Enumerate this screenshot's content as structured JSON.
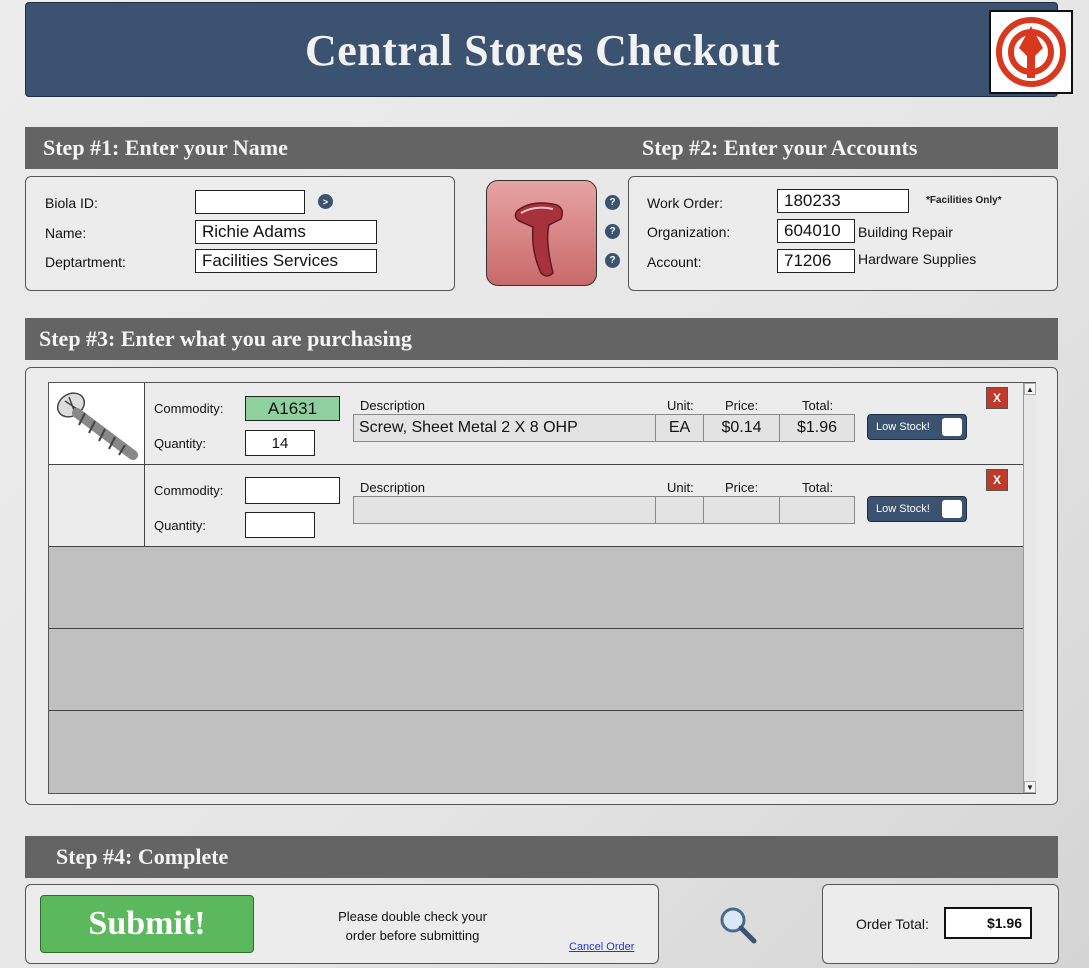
{
  "header": {
    "title": "Central Stores Checkout"
  },
  "step1": {
    "title": "Step #1: Enter your Name",
    "biola_id_label": "Biola ID:",
    "biola_id_value": "",
    "name_label": "Name:",
    "name_value": "Richie Adams",
    "department_label": "Deptartment:",
    "department_value": "Facilities Services"
  },
  "step2": {
    "title": "Step #2: Enter your Accounts",
    "work_order_label": "Work Order:",
    "work_order_value": "180233",
    "facilities_note": "*Facilities Only*",
    "organization_label": "Organization:",
    "organization_value": "604010",
    "organization_name": "Building Repair",
    "account_label": "Account:",
    "account_value": "71206",
    "account_name": "Hardware Supplies"
  },
  "step3": {
    "title": "Step #3: Enter what you are purchasing",
    "labels": {
      "commodity": "Commodity:",
      "quantity": "Quantity:",
      "description": "Description",
      "unit": "Unit:",
      "price": "Price:",
      "total": "Total:",
      "low_stock": "Low Stock!",
      "remove": "X"
    },
    "items": [
      {
        "commodity": "A1631",
        "quantity": "14",
        "description": "Screw, Sheet Metal 2 X 8 OHP",
        "unit": "EA",
        "price": "$0.14",
        "total": "$1.96"
      },
      {
        "commodity": "",
        "quantity": "",
        "description": "",
        "unit": "",
        "price": "",
        "total": ""
      }
    ]
  },
  "step4": {
    "title": "Step #4: Complete",
    "submit_label": "Submit!",
    "message_line1": "Please double check your",
    "message_line2": "order before submitting",
    "cancel_label": "Cancel Order",
    "order_total_label": "Order Total:",
    "order_total_value": "$1.96"
  },
  "colors": {
    "header_bg": "#3b5371",
    "bar_bg": "#646464",
    "commodity_valid": "#8fd19e",
    "submit_green": "#5cb85c",
    "remove_red": "#c0392b"
  },
  "icons": [
    "logo-icon",
    "go-arrow-icon",
    "barcode-scanner-icon",
    "help-icon",
    "screw-icon",
    "magnifier-icon"
  ]
}
